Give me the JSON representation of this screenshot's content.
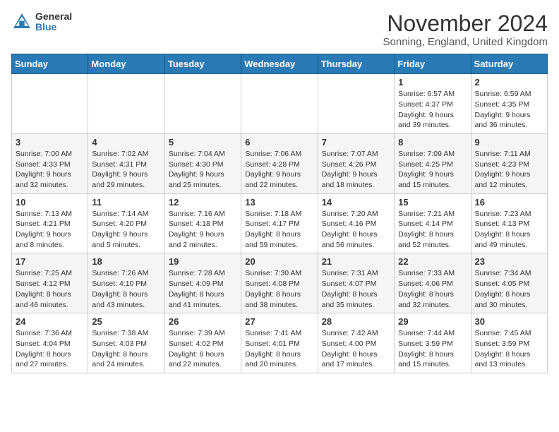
{
  "logo": {
    "general": "General",
    "blue": "Blue"
  },
  "title": "November 2024",
  "location": "Sonning, England, United Kingdom",
  "days_of_week": [
    "Sunday",
    "Monday",
    "Tuesday",
    "Wednesday",
    "Thursday",
    "Friday",
    "Saturday"
  ],
  "weeks": [
    [
      {
        "day": "",
        "info": ""
      },
      {
        "day": "",
        "info": ""
      },
      {
        "day": "",
        "info": ""
      },
      {
        "day": "",
        "info": ""
      },
      {
        "day": "",
        "info": ""
      },
      {
        "day": "1",
        "info": "Sunrise: 6:57 AM\nSunset: 4:37 PM\nDaylight: 9 hours and 39 minutes."
      },
      {
        "day": "2",
        "info": "Sunrise: 6:59 AM\nSunset: 4:35 PM\nDaylight: 9 hours and 36 minutes."
      }
    ],
    [
      {
        "day": "3",
        "info": "Sunrise: 7:00 AM\nSunset: 4:33 PM\nDaylight: 9 hours and 32 minutes."
      },
      {
        "day": "4",
        "info": "Sunrise: 7:02 AM\nSunset: 4:31 PM\nDaylight: 9 hours and 29 minutes."
      },
      {
        "day": "5",
        "info": "Sunrise: 7:04 AM\nSunset: 4:30 PM\nDaylight: 9 hours and 25 minutes."
      },
      {
        "day": "6",
        "info": "Sunrise: 7:06 AM\nSunset: 4:28 PM\nDaylight: 9 hours and 22 minutes."
      },
      {
        "day": "7",
        "info": "Sunrise: 7:07 AM\nSunset: 4:26 PM\nDaylight: 9 hours and 18 minutes."
      },
      {
        "day": "8",
        "info": "Sunrise: 7:09 AM\nSunset: 4:25 PM\nDaylight: 9 hours and 15 minutes."
      },
      {
        "day": "9",
        "info": "Sunrise: 7:11 AM\nSunset: 4:23 PM\nDaylight: 9 hours and 12 minutes."
      }
    ],
    [
      {
        "day": "10",
        "info": "Sunrise: 7:13 AM\nSunset: 4:21 PM\nDaylight: 9 hours and 8 minutes."
      },
      {
        "day": "11",
        "info": "Sunrise: 7:14 AM\nSunset: 4:20 PM\nDaylight: 9 hours and 5 minutes."
      },
      {
        "day": "12",
        "info": "Sunrise: 7:16 AM\nSunset: 4:18 PM\nDaylight: 9 hours and 2 minutes."
      },
      {
        "day": "13",
        "info": "Sunrise: 7:18 AM\nSunset: 4:17 PM\nDaylight: 8 hours and 59 minutes."
      },
      {
        "day": "14",
        "info": "Sunrise: 7:20 AM\nSunset: 4:16 PM\nDaylight: 8 hours and 56 minutes."
      },
      {
        "day": "15",
        "info": "Sunrise: 7:21 AM\nSunset: 4:14 PM\nDaylight: 8 hours and 52 minutes."
      },
      {
        "day": "16",
        "info": "Sunrise: 7:23 AM\nSunset: 4:13 PM\nDaylight: 8 hours and 49 minutes."
      }
    ],
    [
      {
        "day": "17",
        "info": "Sunrise: 7:25 AM\nSunset: 4:12 PM\nDaylight: 8 hours and 46 minutes."
      },
      {
        "day": "18",
        "info": "Sunrise: 7:26 AM\nSunset: 4:10 PM\nDaylight: 8 hours and 43 minutes."
      },
      {
        "day": "19",
        "info": "Sunrise: 7:28 AM\nSunset: 4:09 PM\nDaylight: 8 hours and 41 minutes."
      },
      {
        "day": "20",
        "info": "Sunrise: 7:30 AM\nSunset: 4:08 PM\nDaylight: 8 hours and 38 minutes."
      },
      {
        "day": "21",
        "info": "Sunrise: 7:31 AM\nSunset: 4:07 PM\nDaylight: 8 hours and 35 minutes."
      },
      {
        "day": "22",
        "info": "Sunrise: 7:33 AM\nSunset: 4:06 PM\nDaylight: 8 hours and 32 minutes."
      },
      {
        "day": "23",
        "info": "Sunrise: 7:34 AM\nSunset: 4:05 PM\nDaylight: 8 hours and 30 minutes."
      }
    ],
    [
      {
        "day": "24",
        "info": "Sunrise: 7:36 AM\nSunset: 4:04 PM\nDaylight: 8 hours and 27 minutes."
      },
      {
        "day": "25",
        "info": "Sunrise: 7:38 AM\nSunset: 4:03 PM\nDaylight: 8 hours and 24 minutes."
      },
      {
        "day": "26",
        "info": "Sunrise: 7:39 AM\nSunset: 4:02 PM\nDaylight: 8 hours and 22 minutes."
      },
      {
        "day": "27",
        "info": "Sunrise: 7:41 AM\nSunset: 4:01 PM\nDaylight: 8 hours and 20 minutes."
      },
      {
        "day": "28",
        "info": "Sunrise: 7:42 AM\nSunset: 4:00 PM\nDaylight: 8 hours and 17 minutes."
      },
      {
        "day": "29",
        "info": "Sunrise: 7:44 AM\nSunset: 3:59 PM\nDaylight: 8 hours and 15 minutes."
      },
      {
        "day": "30",
        "info": "Sunrise: 7:45 AM\nSunset: 3:59 PM\nDaylight: 8 hours and 13 minutes."
      }
    ]
  ]
}
